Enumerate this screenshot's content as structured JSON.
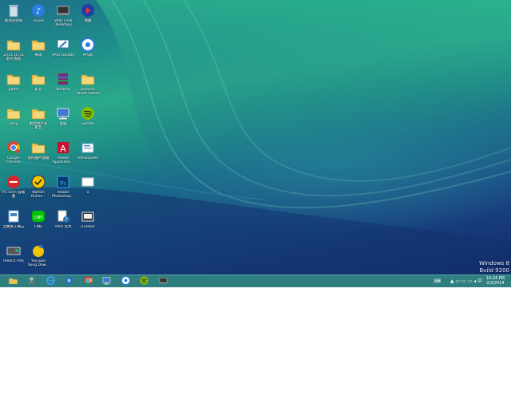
{
  "desktop_icons": [
    {
      "label": "資源回收筒",
      "icon": "recycle-bin-icon"
    },
    {
      "label": "iTunes",
      "icon": "itunes-icon"
    },
    {
      "label": "VAIO Care\n(Desktop)",
      "icon": "vaio-care-icon"
    },
    {
      "label": "博播",
      "icon": "media-player-icon"
    },
    {
      "label": "2013.10.31\n影片快照",
      "icon": "folder-icon"
    },
    {
      "label": "華碩",
      "icon": "folder-icon"
    },
    {
      "label": "VAIO Update",
      "icon": "vaio-update-icon"
    },
    {
      "label": "PPS影",
      "icon": "pps-icon"
    },
    {
      "label": "game",
      "icon": "folder-icon"
    },
    {
      "label": "影音",
      "icon": "folder-icon"
    },
    {
      "label": "WinRAR",
      "icon": "winrar-icon"
    },
    {
      "label": "pictures\nsaved videos",
      "icon": "folder-icon"
    },
    {
      "label": "sony",
      "icon": "folder-icon"
    },
    {
      "label": "數位相片及\n影音",
      "icon": "folder-icon"
    },
    {
      "label": "電腦",
      "icon": "computer-icon"
    },
    {
      "label": "Spotify",
      "icon": "spotify-icon"
    },
    {
      "label": "Google\nChrome",
      "icon": "chrome-icon"
    },
    {
      "label": "我的圖片收藏",
      "icon": "folder-icon"
    },
    {
      "label": "Adobe\nApplicatio...",
      "icon": "adobe-icon"
    },
    {
      "label": "reflexspeed",
      "icon": "document-icon"
    },
    {
      "label": "PC-cillin 雲端\n版",
      "icon": "pccillin-icon"
    },
    {
      "label": "Norton\nOnline...",
      "icon": "norton-icon"
    },
    {
      "label": "Adobe\nPhotoshop...",
      "icon": "photoshop-icon"
    },
    {
      "label": "a",
      "icon": "blank-file-icon"
    },
    {
      "label": "全體員工備忘",
      "icon": "shortcut-icon"
    },
    {
      "label": "LINE",
      "icon": "line-icon"
    },
    {
      "label": "VAIO 常見",
      "icon": "vaio-help-icon"
    },
    {
      "label": "iFunbox",
      "icon": "ifunbox-icon"
    },
    {
      "label": "Predict PVR",
      "icon": "pvr-icon"
    },
    {
      "label": "YouTube\nSong Dow...",
      "icon": "youtube-downloader-icon"
    }
  ],
  "watermark": {
    "line1": "Windows 8",
    "line2": "Build 9200"
  },
  "taskbar": {
    "pinned": [
      {
        "icon": "file-explorer-icon"
      },
      {
        "icon": "user-tile-icon"
      },
      {
        "icon": "internet-explorer-icon"
      },
      {
        "icon": "windows-media-icon"
      },
      {
        "icon": "chrome-icon"
      },
      {
        "icon": "remote-desktop-icon"
      },
      {
        "icon": "pps-icon"
      },
      {
        "icon": "spotify-icon"
      },
      {
        "icon": "vaio-icon"
      }
    ],
    "tray_input": "⌨",
    "tray_glyphs": "▲ ▭ ▭ ▭ ◂ 中",
    "clock_time": "10:24 PM",
    "clock_date": "2/3/2014"
  },
  "colors": {
    "taskbar": "#2f7f80",
    "wallpaper_top": "#2aa98b",
    "wallpaper_bottom": "#112a63"
  }
}
